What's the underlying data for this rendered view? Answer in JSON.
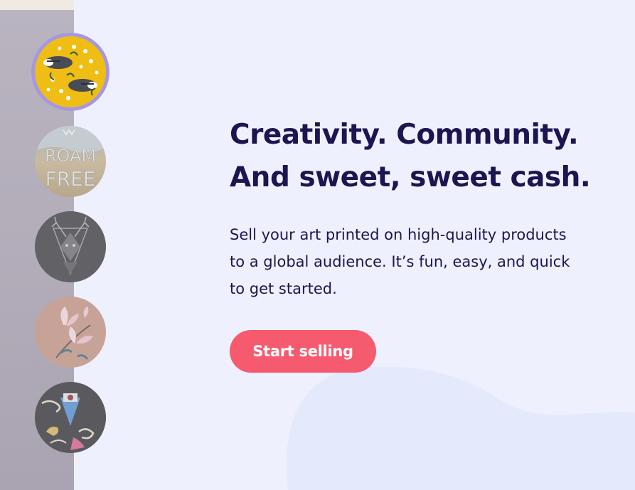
{
  "hero": {
    "headline_line1": "Creativity. Community.",
    "headline_line2": "And sweet, sweet cash.",
    "body_line1": "Sell your art printed on high-quality products",
    "body_line2": "to a global audience. It’s fun, easy, and quick",
    "body_line3": "to get started.",
    "cta_label": "Start selling"
  },
  "thumbnails": [
    {
      "id": "badgers-floral",
      "active": true
    },
    {
      "id": "roam-free"
    },
    {
      "id": "geometric-stag"
    },
    {
      "id": "magnolia-flowers"
    },
    {
      "id": "eye-illustration"
    }
  ],
  "colors": {
    "background": "#eef1fd",
    "headline": "#1d1551",
    "cta_background": "#f65a6f",
    "active_ring": "#a597e2"
  }
}
